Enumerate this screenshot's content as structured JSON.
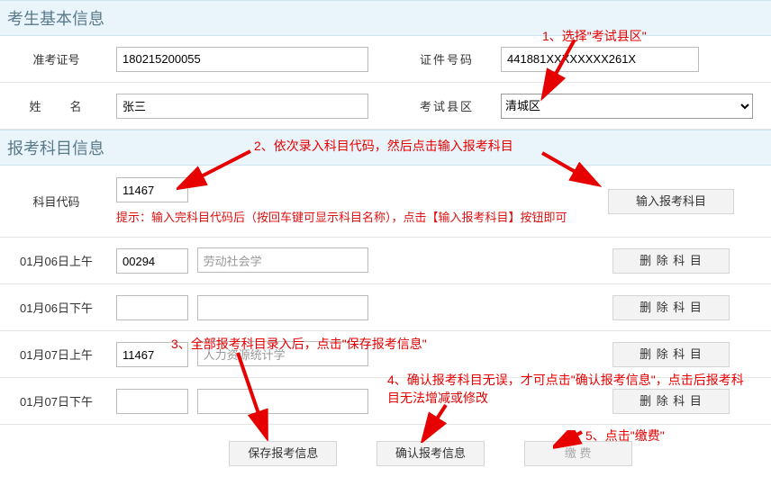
{
  "sections": {
    "basic": "考生基本信息",
    "subjects": "报考科目信息"
  },
  "basic": {
    "ticket_label": "准考证号",
    "ticket_value": "180215200055",
    "id_label": "证件号码",
    "id_value": "441881XXXXXXXX261X",
    "name_label": "姓　　名",
    "name_value": "张三",
    "county_label": "考试县区",
    "county_value": "清城区"
  },
  "subject_entry": {
    "label": "科目代码",
    "code_value": "11467",
    "btn_input": "输入报考科目",
    "hint": "提示：输入完科目代码后（按回车键可显示科目名称），点击【输入报考科目】按钮即可"
  },
  "slots": [
    {
      "label": "01月06日上午",
      "code": "00294",
      "name": "劳动社会学"
    },
    {
      "label": "01月06日下午",
      "code": "",
      "name": ""
    },
    {
      "label": "01月07日上午",
      "code": "11467",
      "name": "人力资源统计学"
    },
    {
      "label": "01月07日下午",
      "code": "",
      "name": ""
    }
  ],
  "btn_delete": "删 除 科 目",
  "actions": {
    "save": "保存报考信息",
    "confirm": "确认报考信息",
    "pay": "缴 费"
  },
  "annotations": {
    "a1": "1、选择\"考试县区\"",
    "a2": "2、依次录入科目代码，然后点击输入报考科目",
    "a3": "3、全部报考科目录入后，点击\"保存报考信息\"",
    "a4": "4、确认报考科目无误，才可点击\"确认报考信息\"，点击后报考科目无法增减或修改",
    "a5": "5、点击\"缴费\""
  }
}
